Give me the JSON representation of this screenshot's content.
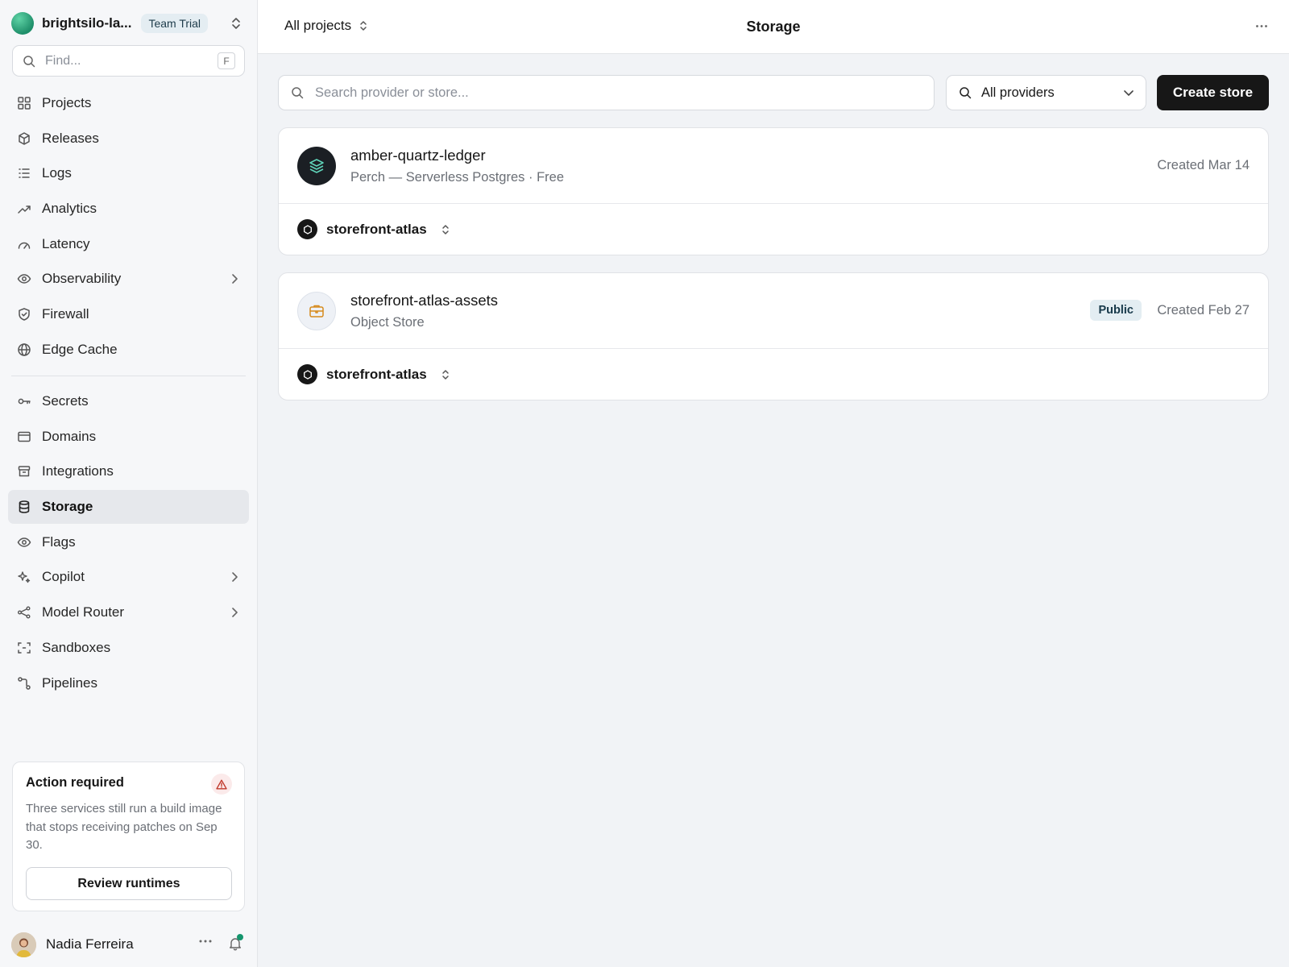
{
  "team": {
    "name": "brightsilo-la...",
    "plan_badge": "Team Trial"
  },
  "find": {
    "placeholder": "Find...",
    "shortcut": "F"
  },
  "nav_primary": [
    {
      "label": "Projects",
      "icon": "grid-icon"
    },
    {
      "label": "Releases",
      "icon": "cube-icon"
    },
    {
      "label": "Logs",
      "icon": "list-icon"
    },
    {
      "label": "Analytics",
      "icon": "trend-icon"
    },
    {
      "label": "Latency",
      "icon": "gauge-icon"
    },
    {
      "label": "Observability",
      "icon": "eye-icon"
    },
    {
      "label": "Firewall",
      "icon": "shield-icon"
    },
    {
      "label": "Edge Cache",
      "icon": "globe-icon"
    }
  ],
  "nav_secondary": [
    {
      "label": "Secrets",
      "icon": "key-icon"
    },
    {
      "label": "Domains",
      "icon": "window-icon"
    },
    {
      "label": "Integrations",
      "icon": "box-icon"
    },
    {
      "label": "Storage",
      "icon": "database-icon"
    },
    {
      "label": "Flags",
      "icon": "eye-icon"
    },
    {
      "label": "Copilot",
      "icon": "sparkle-icon"
    },
    {
      "label": "Model Router",
      "icon": "network-icon"
    },
    {
      "label": "Sandboxes",
      "icon": "frame-icon"
    },
    {
      "label": "Pipelines",
      "icon": "pipeline-icon"
    }
  ],
  "alert": {
    "title": "Action required",
    "body": "Three services still run a build image that stops receiving patches on Sep 30.",
    "button": "Review runtimes"
  },
  "user": {
    "name": "Nadia Ferreira"
  },
  "topbar": {
    "project_selector": "All projects",
    "title": "Storage"
  },
  "toolbar": {
    "search_placeholder": "Search provider or store...",
    "provider_filter": "All providers",
    "create_button": "Create store"
  },
  "stores": [
    {
      "name": "amber-quartz-ledger",
      "subtitle": "Perch — Serverless Postgres · Free",
      "created": "Created Mar 14",
      "project": "storefront-atlas"
    },
    {
      "name": "storefront-atlas-assets",
      "subtitle": "Object Store",
      "badge": "Public",
      "created": "Created Feb 27",
      "project": "storefront-atlas"
    }
  ],
  "colors": {
    "accent_dark": "#171717",
    "active_nav_bg": "#e6e8ec",
    "status_green": "#14956d",
    "warning_red": "#c0392b",
    "public_badge_bg": "#e3edf2"
  }
}
